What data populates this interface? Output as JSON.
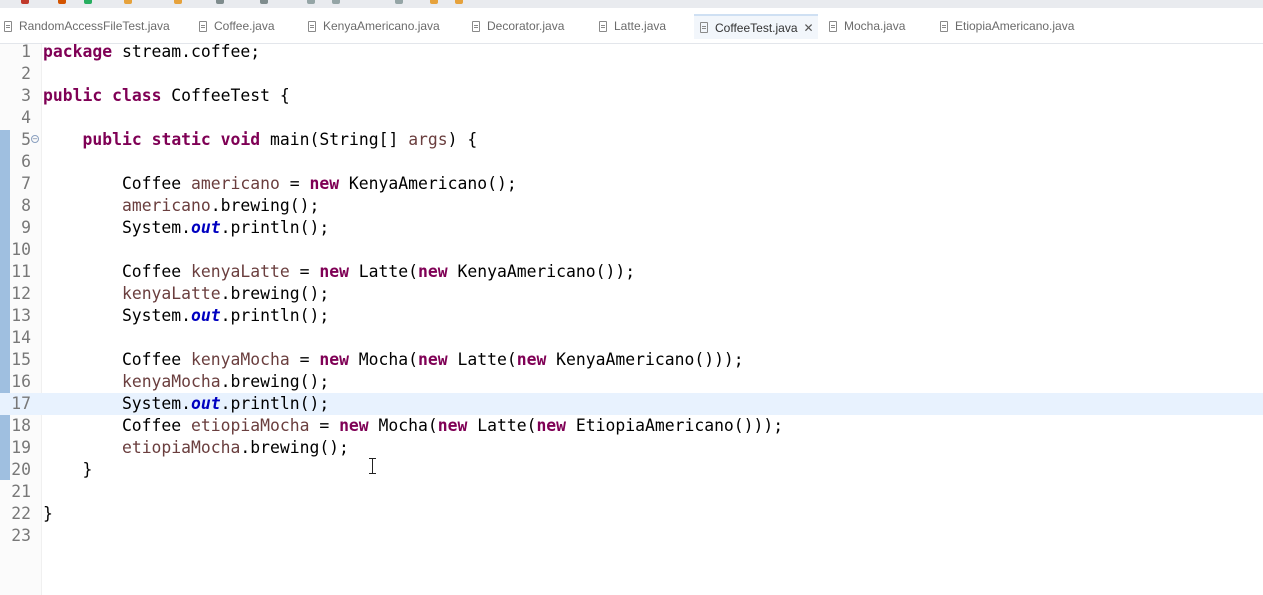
{
  "tabs": [
    {
      "label": "RandomAccessFileTest.java",
      "active": false
    },
    {
      "label": "Coffee.java",
      "active": false
    },
    {
      "label": "KenyaAmericano.java",
      "active": false
    },
    {
      "label": "Decorator.java",
      "active": false
    },
    {
      "label": "Latte.java",
      "active": false
    },
    {
      "label": "CoffeeTest.java",
      "active": true
    },
    {
      "label": "Mocha.java",
      "active": false
    },
    {
      "label": "EtiopiaAmericano.java",
      "active": false
    }
  ],
  "tab_close_glyph": "✕",
  "editor": {
    "current_line": 17,
    "line_numbers": [
      "1",
      "2",
      "3",
      "4",
      "5",
      "6",
      "7",
      "8",
      "9",
      "10",
      "11",
      "12",
      "13",
      "14",
      "15",
      "16",
      "17",
      "18",
      "19",
      "20",
      "21",
      "22",
      "23"
    ],
    "fold_marker_line": 5,
    "fold_glyph": "−",
    "colors": {
      "keyword": "#7f0055",
      "local_variable": "#6a3e3e",
      "static_field": "#0000c0",
      "current_line_bg": "#e8f2fe",
      "change_bar": "#9fbfe0"
    },
    "lines": [
      [
        {
          "t": "kw",
          "v": "package"
        },
        {
          "t": "p",
          "v": " stream.coffee;"
        }
      ],
      [],
      [
        {
          "t": "kw",
          "v": "public"
        },
        {
          "t": "p",
          "v": " "
        },
        {
          "t": "kw",
          "v": "class"
        },
        {
          "t": "p",
          "v": " CoffeeTest {"
        }
      ],
      [],
      [
        {
          "t": "p",
          "v": "    "
        },
        {
          "t": "kw",
          "v": "public"
        },
        {
          "t": "p",
          "v": " "
        },
        {
          "t": "kw",
          "v": "static"
        },
        {
          "t": "p",
          "v": " "
        },
        {
          "t": "kw",
          "v": "void"
        },
        {
          "t": "p",
          "v": " main(String[] "
        },
        {
          "t": "var",
          "v": "args"
        },
        {
          "t": "p",
          "v": ") {"
        }
      ],
      [],
      [
        {
          "t": "p",
          "v": "        Coffee "
        },
        {
          "t": "var",
          "v": "americano"
        },
        {
          "t": "p",
          "v": " = "
        },
        {
          "t": "kw",
          "v": "new"
        },
        {
          "t": "p",
          "v": " KenyaAmericano();"
        }
      ],
      [
        {
          "t": "p",
          "v": "        "
        },
        {
          "t": "var",
          "v": "americano"
        },
        {
          "t": "p",
          "v": ".brewing();"
        }
      ],
      [
        {
          "t": "p",
          "v": "        System."
        },
        {
          "t": "stat",
          "v": "out"
        },
        {
          "t": "p",
          "v": ".println();"
        }
      ],
      [],
      [
        {
          "t": "p",
          "v": "        Coffee "
        },
        {
          "t": "var",
          "v": "kenyaLatte"
        },
        {
          "t": "p",
          "v": " = "
        },
        {
          "t": "kw",
          "v": "new"
        },
        {
          "t": "p",
          "v": " Latte("
        },
        {
          "t": "kw",
          "v": "new"
        },
        {
          "t": "p",
          "v": " KenyaAmericano());"
        }
      ],
      [
        {
          "t": "p",
          "v": "        "
        },
        {
          "t": "var",
          "v": "kenyaLatte"
        },
        {
          "t": "p",
          "v": ".brewing();"
        }
      ],
      [
        {
          "t": "p",
          "v": "        System."
        },
        {
          "t": "stat",
          "v": "out"
        },
        {
          "t": "p",
          "v": ".println();"
        }
      ],
      [],
      [
        {
          "t": "p",
          "v": "        Coffee "
        },
        {
          "t": "var",
          "v": "kenyaMocha"
        },
        {
          "t": "p",
          "v": " = "
        },
        {
          "t": "kw",
          "v": "new"
        },
        {
          "t": "p",
          "v": " Mocha("
        },
        {
          "t": "kw",
          "v": "new"
        },
        {
          "t": "p",
          "v": " Latte("
        },
        {
          "t": "kw",
          "v": "new"
        },
        {
          "t": "p",
          "v": " KenyaAmericano()));"
        }
      ],
      [
        {
          "t": "p",
          "v": "        "
        },
        {
          "t": "var",
          "v": "kenyaMocha"
        },
        {
          "t": "p",
          "v": ".brewing();"
        }
      ],
      [
        {
          "t": "p",
          "v": "        System."
        },
        {
          "t": "stat",
          "v": "out"
        },
        {
          "t": "p",
          "v": ".println();"
        }
      ],
      [
        {
          "t": "p",
          "v": "        Coffee "
        },
        {
          "t": "var",
          "v": "etiopiaMocha"
        },
        {
          "t": "p",
          "v": " = "
        },
        {
          "t": "kw",
          "v": "new"
        },
        {
          "t": "p",
          "v": " Mocha("
        },
        {
          "t": "kw",
          "v": "new"
        },
        {
          "t": "p",
          "v": " Latte("
        },
        {
          "t": "kw",
          "v": "new"
        },
        {
          "t": "p",
          "v": " EtiopiaAmericano()));"
        }
      ],
      [
        {
          "t": "p",
          "v": "        "
        },
        {
          "t": "var",
          "v": "etiopiaMocha"
        },
        {
          "t": "p",
          "v": ".brewing();"
        }
      ],
      [
        {
          "t": "p",
          "v": "    }"
        }
      ],
      [],
      [
        {
          "t": "p",
          "v": "}"
        }
      ],
      []
    ]
  }
}
